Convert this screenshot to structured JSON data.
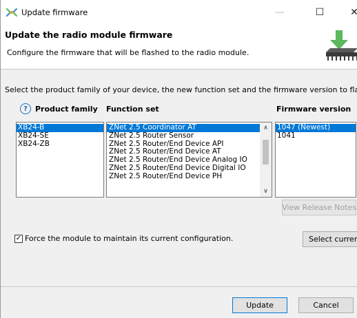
{
  "window": {
    "title": "Update firmware",
    "controls": {
      "minimize": "—",
      "maximize": "☐",
      "close": "✕"
    },
    "icon": "firmware-icon"
  },
  "banner": {
    "title": "Update the radio module firmware",
    "subtitle": "Configure the firmware that will be flashed to the radio module.",
    "icon": "chip-download-icon"
  },
  "instructions": "Select the product family of your device, the new function set and the firmware version to flash:",
  "help_icon": "?",
  "columns": {
    "product_family": "Product family",
    "function_set": "Function set",
    "firmware_version": "Firmware version"
  },
  "product_family": {
    "items": [
      "XB24-B",
      "XB24-SE",
      "XB24-ZB"
    ],
    "selected": "XB24-B"
  },
  "function_set": {
    "items": [
      "ZNet 2.5 Coordinator AT",
      "ZNet 2.5 Router Sensor",
      "ZNet 2.5 Router/End Device API",
      "ZNet 2.5 Router/End Device AT",
      "ZNet 2.5 Router/End Device Analog IO",
      "ZNet 2.5 Router/End Device Digital IO",
      "ZNet 2.5 Router/End Device PH"
    ],
    "selected": "ZNet 2.5 Coordinator AT",
    "scroll_up": "∧",
    "scroll_down": "∨"
  },
  "firmware_version": {
    "items": [
      "1047 (Newest)",
      "1041"
    ],
    "selected": "1047 (Newest)"
  },
  "buttons": {
    "view_release_notes": "View Release Notes",
    "select_current": "Select current",
    "update": "Update",
    "cancel": "Cancel"
  },
  "force_config": {
    "label": "Force the module to maintain its current configuration.",
    "checked": true,
    "mark": "✓"
  },
  "colors": {
    "selection": "#0078d7",
    "icon_green": "#5cb85c",
    "chip_gray": "#3a3a3a"
  }
}
